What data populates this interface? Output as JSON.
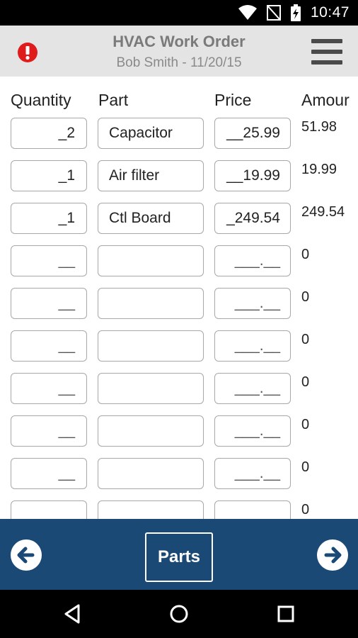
{
  "status_bar": {
    "time": "10:47",
    "icons": [
      "wifi-icon",
      "no-sim-icon",
      "battery-charging-icon"
    ]
  },
  "header": {
    "title": "HVAC Work Order",
    "subtitle": "Bob Smith - 11/20/15",
    "alert_icon": "alert-icon",
    "menu_icon": "hamburger-menu-icon",
    "alert_color": "#e01b1b"
  },
  "table": {
    "columns": [
      "Quantity",
      "Part",
      "Price",
      "Amour"
    ],
    "rows": [
      {
        "quantity": "_2",
        "part": "Capacitor",
        "price": "__25.99",
        "amount": "51.98"
      },
      {
        "quantity": "_1",
        "part": "Air filter",
        "price": "__19.99",
        "amount": "19.99"
      },
      {
        "quantity": "_1",
        "part": "Ctl Board",
        "price": "_249.54",
        "amount": "249.54"
      },
      {
        "quantity": "__",
        "part": "",
        "price": "___.__",
        "amount": "0"
      },
      {
        "quantity": "__",
        "part": "",
        "price": "___.__",
        "amount": "0"
      },
      {
        "quantity": "__",
        "part": "",
        "price": "___.__",
        "amount": "0"
      },
      {
        "quantity": "__",
        "part": "",
        "price": "___.__",
        "amount": "0"
      },
      {
        "quantity": "__",
        "part": "",
        "price": "___.__",
        "amount": "0"
      },
      {
        "quantity": "__",
        "part": "",
        "price": "___.__",
        "amount": "0"
      },
      {
        "quantity": "",
        "part": "",
        "price": "",
        "amount": "0"
      }
    ]
  },
  "bottom_bar": {
    "parts_label": "Parts",
    "prev_icon": "arrow-left-circle-icon",
    "next_icon": "arrow-right-circle-icon",
    "background_color": "#1a4976"
  },
  "nav_bar": {
    "icons": [
      "back-icon",
      "home-icon",
      "recents-icon"
    ]
  }
}
